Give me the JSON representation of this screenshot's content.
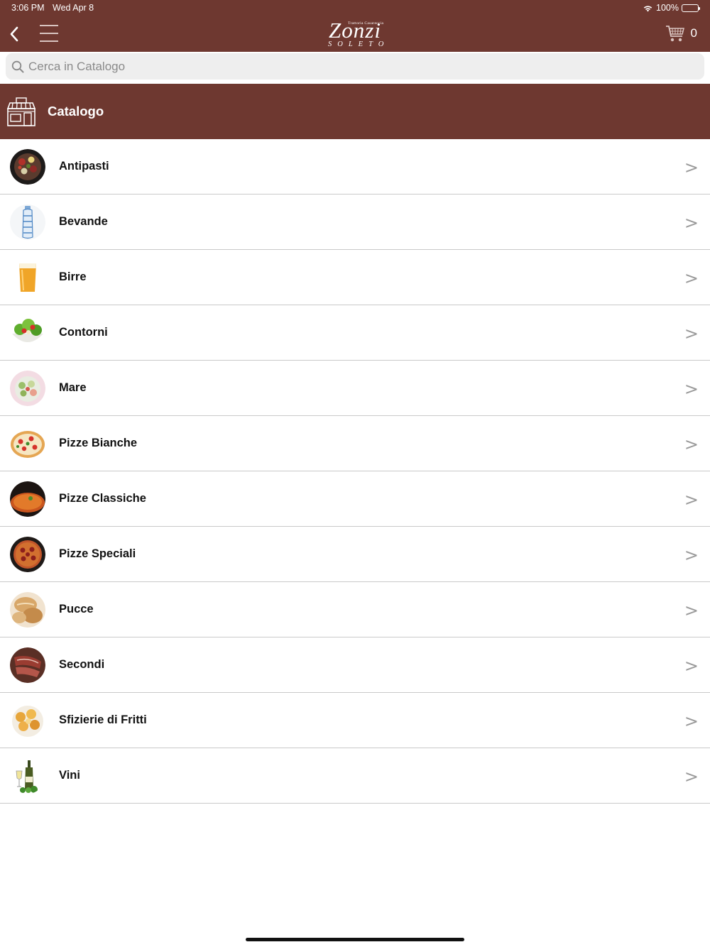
{
  "status_bar": {
    "time": "3:06 PM",
    "date": "Wed Apr 8",
    "battery": "100%"
  },
  "nav": {
    "logo_tagline": "Trattoria Casareccia",
    "logo_brand": "Zonzi",
    "logo_city": "SOLETO",
    "cart_count": "0"
  },
  "search": {
    "placeholder": "Cerca in Catalogo",
    "value": ""
  },
  "section": {
    "title": "Catalogo"
  },
  "categories": [
    {
      "label": "Antipasti",
      "thumb": "antipasti-platter"
    },
    {
      "label": "Bevande",
      "thumb": "water-bottle"
    },
    {
      "label": "Birre",
      "thumb": "beer-glass"
    },
    {
      "label": "Contorni",
      "thumb": "salad-bowl"
    },
    {
      "label": "Mare",
      "thumb": "seafood-salad"
    },
    {
      "label": "Pizze Bianche",
      "thumb": "white-pizza"
    },
    {
      "label": "Pizze Classiche",
      "thumb": "classic-pizza"
    },
    {
      "label": "Pizze Speciali",
      "thumb": "special-pizza"
    },
    {
      "label": "Pucce",
      "thumb": "bread-rolls"
    },
    {
      "label": "Secondi",
      "thumb": "meat-dish"
    },
    {
      "label": "Sfizierie di Fritti",
      "thumb": "fried-food"
    },
    {
      "label": "Vini",
      "thumb": "wine-bottles"
    }
  ],
  "chevron": ">",
  "colors": {
    "brand": "#6e3830",
    "row_divider": "#c9c9c9"
  }
}
